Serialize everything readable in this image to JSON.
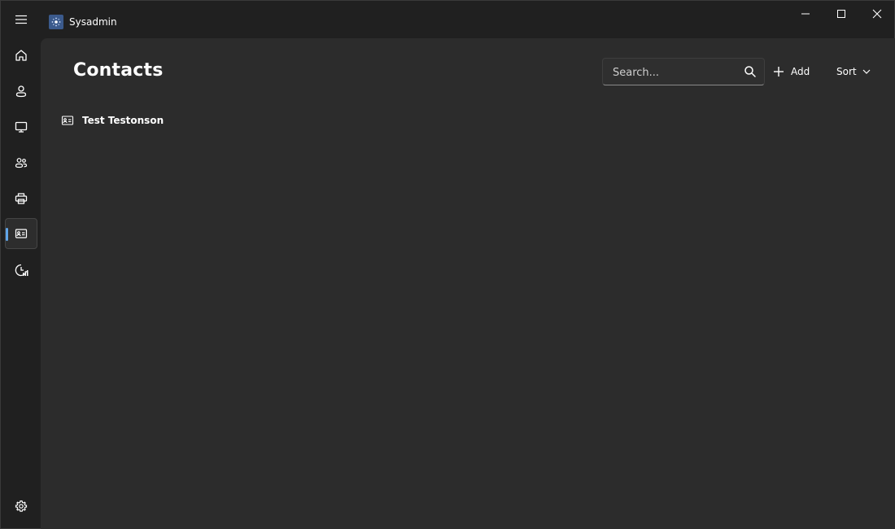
{
  "window": {
    "app_title": "Sysadmin",
    "icons": {
      "app": "app-logo-icon",
      "minimize": "minimize-icon",
      "maximize": "maximize-icon",
      "close": "close-icon"
    }
  },
  "nav": {
    "items": [
      {
        "name": "nav-menu",
        "icon": "hamburger-menu-icon"
      },
      {
        "name": "nav-home",
        "icon": "home-icon"
      },
      {
        "name": "nav-users",
        "icon": "person-icon"
      },
      {
        "name": "nav-computers",
        "icon": "monitor-icon"
      },
      {
        "name": "nav-groups",
        "icon": "people-icon"
      },
      {
        "name": "nav-printers",
        "icon": "printer-icon"
      },
      {
        "name": "nav-contacts",
        "icon": "contact-card-icon",
        "selected": true
      },
      {
        "name": "nav-reports",
        "icon": "chart-clock-icon"
      },
      {
        "name": "nav-settings",
        "icon": "gear-icon"
      }
    ],
    "accent_color": "#60a5e8"
  },
  "main": {
    "title": "Contacts",
    "search": {
      "placeholder": "Search...",
      "value": ""
    },
    "add_label": "Add",
    "sort_label": "Sort",
    "contacts": [
      {
        "name": "Test Testonson",
        "icon": "contact-card-icon"
      }
    ]
  }
}
